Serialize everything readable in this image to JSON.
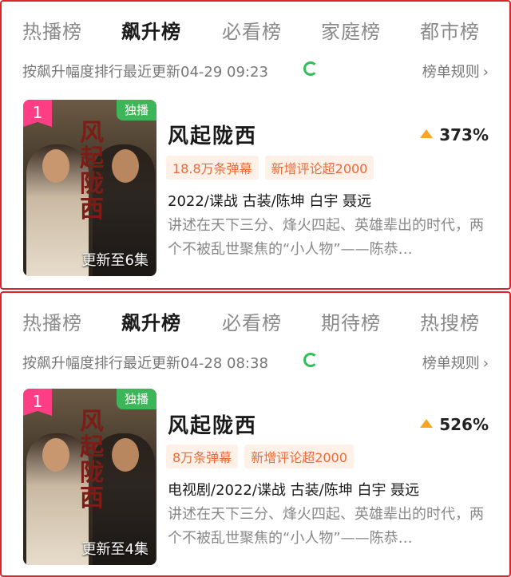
{
  "panels": [
    {
      "tabs": [
        "热播榜",
        "飙升榜",
        "必看榜",
        "家庭榜",
        "都市榜"
      ],
      "active_tab": "飙升榜",
      "sort_text": "按飙升幅度排行最近更新04-29 09:23",
      "rules_label": "榜单规则",
      "item": {
        "rank": "1",
        "badge": "独播",
        "episode_text": "更新至6集",
        "title": "风起陇西",
        "rise": "373%",
        "tags": [
          "18.8万条弹幕",
          "新增评论超2000"
        ],
        "meta": "2022/谍战 古装/陈坤 白宇 聂远",
        "description": "讲述在天下三分、烽火四起、英雄辈出的时代，两个不被乱世聚焦的“小人物”——陈恭…",
        "poster_calligraphy": "风起陇西"
      }
    },
    {
      "tabs": [
        "热播榜",
        "飙升榜",
        "必看榜",
        "期待榜",
        "热搜榜"
      ],
      "active_tab": "飙升榜",
      "sort_text": "按飙升幅度排行最近更新04-28 08:38",
      "rules_label": "榜单规则",
      "item": {
        "rank": "1",
        "badge": "独播",
        "episode_text": "更新至4集",
        "title": "风起陇西",
        "rise": "526%",
        "tags": [
          "8万条弹幕",
          "新增评论超2000"
        ],
        "meta": "电视剧/2022/谍战 古装/陈坤 白宇 聂远",
        "description": "讲述在天下三分、烽火四起、英雄辈出的时代，两个不被乱世聚焦的“小人物”——陈恭…",
        "poster_calligraphy": "风起陇西"
      }
    }
  ],
  "icons": {
    "refresh": "refresh-icon",
    "chevron": "chevron-right-icon",
    "rise": "triangle-up-icon"
  },
  "colors": {
    "frame": "#d9262e",
    "tab_highlight": "#ffdf3a",
    "rank_badge": "#ff3e86",
    "exclusive_badge": "#3db559",
    "tag_text": "#ee6a38",
    "rise_arrow": "#f5a623"
  }
}
